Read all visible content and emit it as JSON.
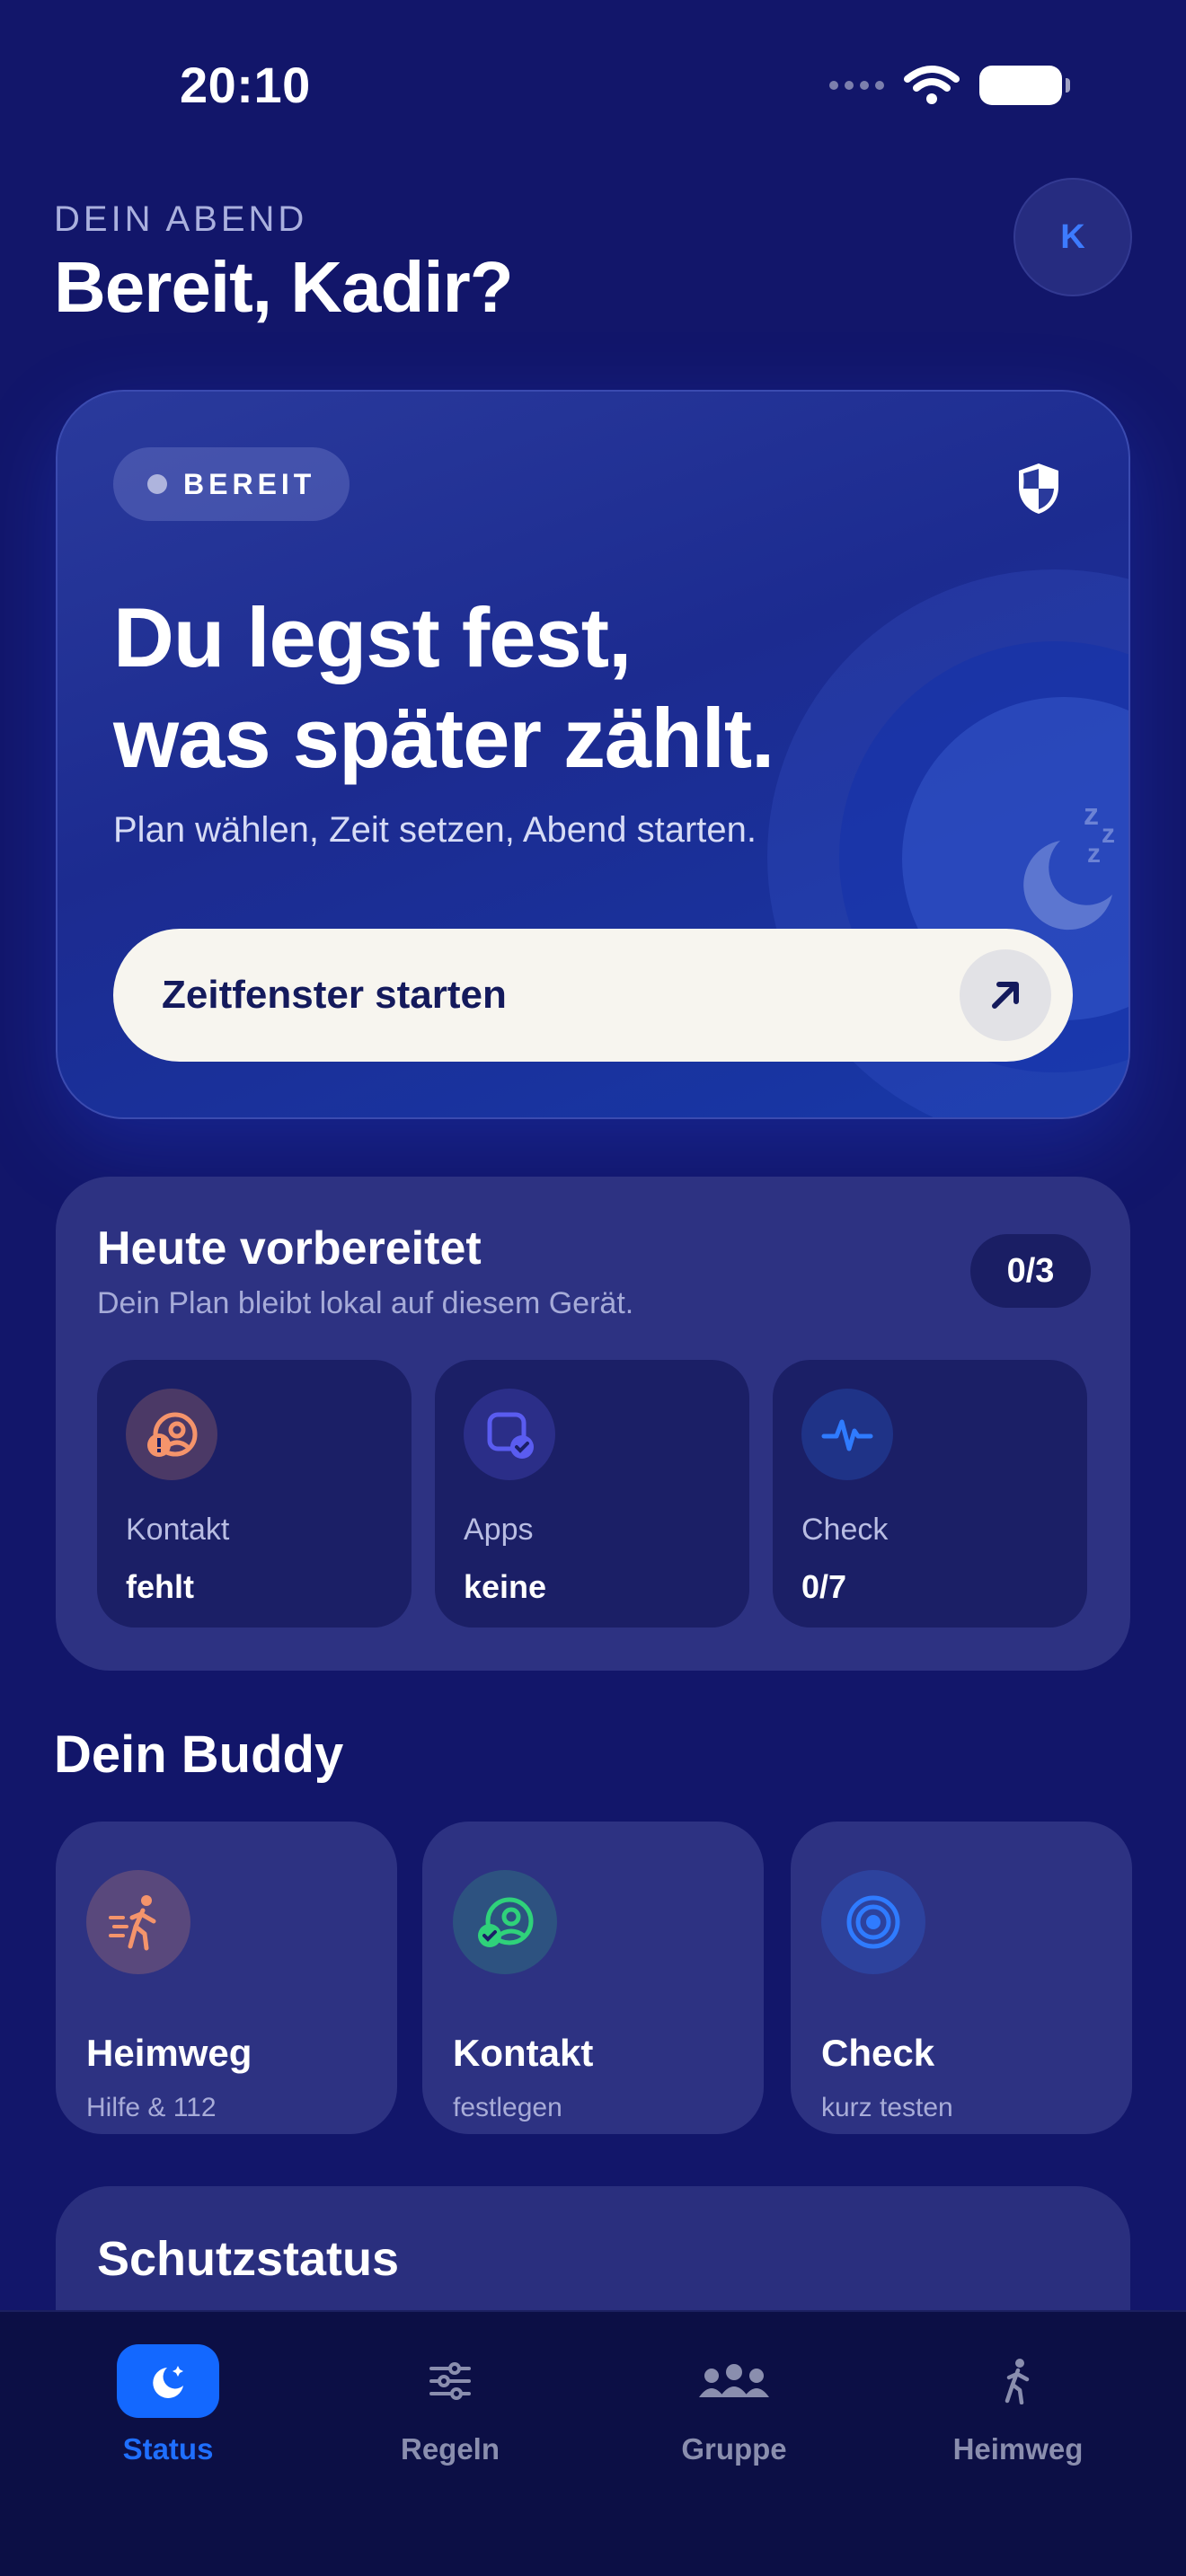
{
  "status_bar": {
    "time": "20:10"
  },
  "header": {
    "eyebrow": "DEIN ABEND",
    "greeting": "Bereit, Kadir?",
    "avatar_initial": "K"
  },
  "hero": {
    "badge": "BEREIT",
    "title_line1": "Du legst fest,",
    "title_line2": "was später zählt.",
    "subtitle": "Plan wählen, Zeit setzen, Abend starten.",
    "cta_label": "Zeitfenster starten",
    "icons": [
      "shield-icon",
      "moon-sleep-icon",
      "arrow-up-right-icon"
    ]
  },
  "prepared": {
    "title": "Heute vorbereitet",
    "subtitle": "Dein Plan bleibt lokal auf diesem Gerät.",
    "count": "0/3",
    "tiles": [
      {
        "label": "Kontakt",
        "value": "fehlt",
        "icon": "contact-alert-icon",
        "color": "#f5946b"
      },
      {
        "label": "Apps",
        "value": "keine",
        "icon": "apps-check-icon",
        "color": "#5a5cf0"
      },
      {
        "label": "Check",
        "value": "0/7",
        "icon": "pulse-icon",
        "color": "#2f7bff"
      }
    ]
  },
  "buddy": {
    "heading": "Dein Buddy",
    "cards": [
      {
        "title": "Heimweg",
        "subtitle": "Hilfe & 112",
        "icon": "walking-icon",
        "color": "#f5946b"
      },
      {
        "title": "Kontakt",
        "subtitle": "festlegen",
        "icon": "contact-check-icon",
        "color": "#2fd27a"
      },
      {
        "title": "Check",
        "subtitle": "kurz testen",
        "icon": "target-icon",
        "color": "#2f7bff"
      }
    ]
  },
  "schutz": {
    "title": "Schutzstatus"
  },
  "tabbar": {
    "active": "Status",
    "accent": "#1368ff",
    "tabs": [
      {
        "label": "Status",
        "icon": "moon-icon"
      },
      {
        "label": "Regeln",
        "icon": "sliders-icon"
      },
      {
        "label": "Gruppe",
        "icon": "group-icon"
      },
      {
        "label": "Heimweg",
        "icon": "walking-icon"
      }
    ]
  }
}
